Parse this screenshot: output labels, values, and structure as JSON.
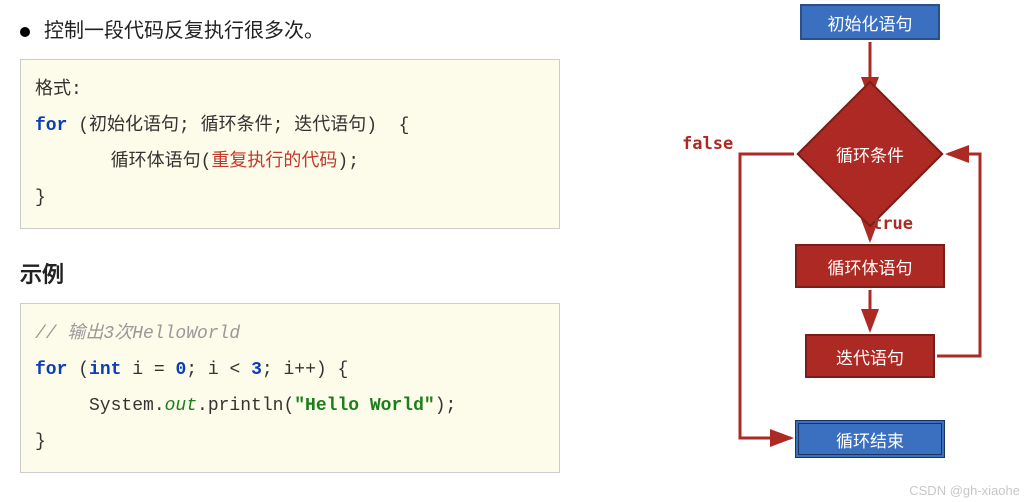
{
  "bullet": "控制一段代码反复执行很多次。",
  "format_box": {
    "line1_label": "格式:",
    "line2_kw": "for",
    "line2_args": " (初始化语句; 循环条件; 迭代语句)  {",
    "line3_prefix": "       循环体语句(",
    "line3_red": "重复执行的代码",
    "line3_suffix": ");",
    "line4": "}"
  },
  "example_heading": "示例",
  "example_box": {
    "comment": "// 输出3次HelloWorld",
    "for_kw": "for",
    "int_kw": "int",
    "var": " i = ",
    "zero": "0",
    "cond_prefix": "; i < ",
    "three": "3",
    "iter": "; i++) {",
    "print_prefix": "     System.",
    "out": "out",
    "print_mid": ".println(",
    "str": "\"Hello World\"",
    "print_suffix": ");",
    "close": "}"
  },
  "flow": {
    "start": "初始化语句",
    "cond": "循环条件",
    "body": "循环体语句",
    "iter": "迭代语句",
    "end": "循环结束",
    "true_label": "true",
    "false_label": "false"
  },
  "watermark": "CSDN @gh-xiaohe",
  "colors": {
    "red_box": "#ad2a24",
    "blue_box": "#3b6fbf",
    "arrow": "#ad2a24"
  }
}
